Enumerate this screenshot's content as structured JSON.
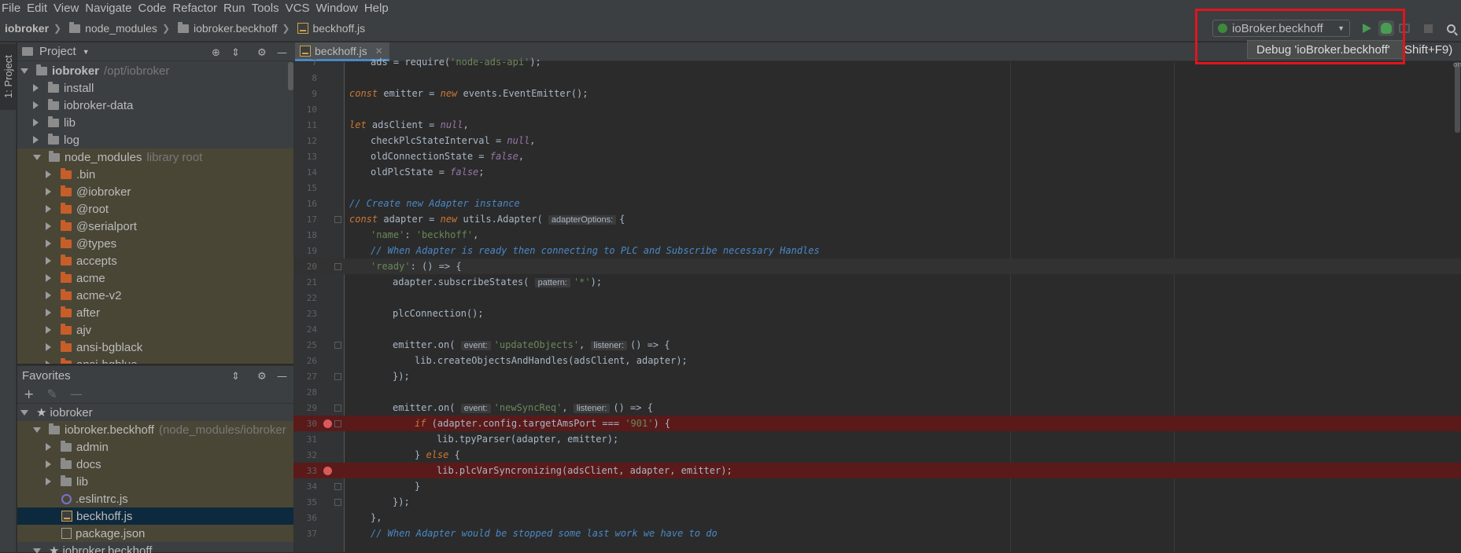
{
  "menu": [
    "File",
    "Edit",
    "View",
    "Navigate",
    "Code",
    "Refactor",
    "Run",
    "Tools",
    "VCS",
    "Window",
    "Help"
  ],
  "breadcrumb": {
    "root": "iobroker",
    "c1": "node_modules",
    "c2": "iobroker.beckhoff",
    "c3": "beckhoff.js"
  },
  "run": {
    "config": "ioBroker.beckhoff",
    "tooltip": "Debug 'ioBroker.beckhoff'",
    "shortcut": "Shift+F9)"
  },
  "stripe": {
    "project_tab": "1: Project"
  },
  "project": {
    "title": "Project",
    "root_name": "iobroker",
    "root_path": "/opt/iobroker",
    "items": [
      "install",
      "iobroker-data",
      "lib",
      "log"
    ],
    "node_modules": "node_modules",
    "node_modules_hint": "library root",
    "modules": [
      ".bin",
      "@iobroker",
      "@root",
      "@serialport",
      "@types",
      "accepts",
      "acme",
      "acme-v2",
      "after",
      "ajv",
      "ansi-bgblack",
      "ansi-bgblue"
    ]
  },
  "favorites": {
    "title": "Favorites",
    "root": "iobroker",
    "project": "iobroker.beckhoff",
    "project_hint": "(node_modules/iobroker",
    "folders": [
      "admin",
      "docs",
      "lib"
    ],
    "files": [
      ".eslintrc.js",
      "beckhoff.js",
      "package.json"
    ],
    "bottom": "iobroker.beckhoff"
  },
  "editor": {
    "tab": "beckhoff.js",
    "overview": "on"
  }
}
